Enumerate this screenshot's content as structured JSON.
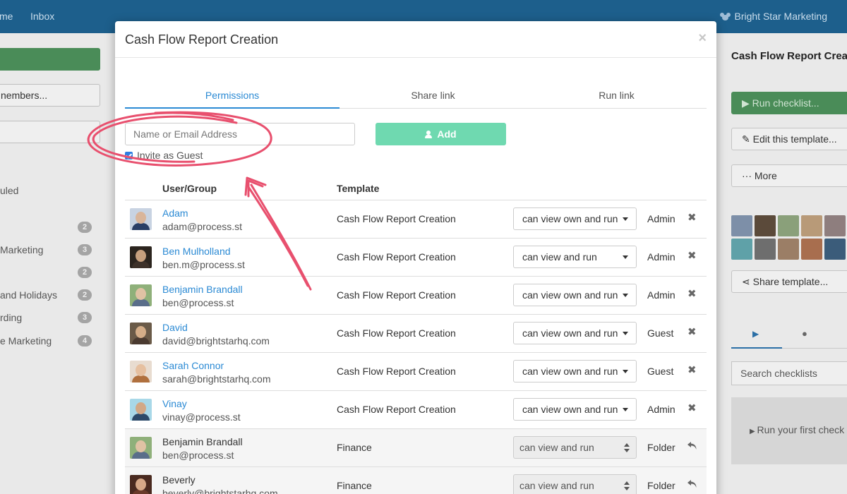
{
  "topbar": {
    "nav_home_fragment": "me",
    "nav_inbox": "Inbox",
    "org_name": "Bright Star Marketing"
  },
  "left_sidebar": {
    "members_fragment": "nembers...",
    "items": [
      {
        "label": "uled",
        "badge": ""
      },
      {
        "label": "",
        "badge": "2"
      },
      {
        "label": "Marketing",
        "badge": "3"
      },
      {
        "label": "",
        "badge": "2"
      },
      {
        "label": "and Holidays",
        "badge": "2"
      },
      {
        "label": "rding",
        "badge": "3"
      },
      {
        "label": "e Marketing",
        "badge": "4"
      }
    ]
  },
  "right_sidebar": {
    "title": "Cash Flow Report Crea",
    "run_checklist": "Run checklist...",
    "edit_template": "Edit this template...",
    "more": "More",
    "share_template": "Share template...",
    "search_placeholder": "Search checklists",
    "empty_state": "Run your first check"
  },
  "modal": {
    "title": "Cash Flow Report Creation",
    "close": "×",
    "tabs": [
      {
        "label": "Permissions",
        "active": true
      },
      {
        "label": "Share link",
        "active": false
      },
      {
        "label": "Run link",
        "active": false
      }
    ],
    "input_placeholder": "Name or Email Address",
    "invite_guest_label": "Invite as Guest",
    "invite_guest_checked": true,
    "add_button": "Add",
    "table": {
      "headers": {
        "user_group": "User/Group",
        "template": "Template"
      },
      "rows": [
        {
          "name": "Adam",
          "email": "adam@process.st",
          "template": "Cash Flow Report Creation",
          "permission": "can view own and run",
          "role": "Admin",
          "inherited": false
        },
        {
          "name": "Ben Mulholland",
          "email": "ben.m@process.st",
          "template": "Cash Flow Report Creation",
          "permission": "can view and run",
          "role": "Admin",
          "inherited": false
        },
        {
          "name": "Benjamin Brandall",
          "email": "ben@process.st",
          "template": "Cash Flow Report Creation",
          "permission": "can view own and run",
          "role": "Admin",
          "inherited": false
        },
        {
          "name": "David",
          "email": "david@brightstarhq.com",
          "template": "Cash Flow Report Creation",
          "permission": "can view own and run",
          "role": "Guest",
          "inherited": false
        },
        {
          "name": "Sarah Connor",
          "email": "sarah@brightstarhq.com",
          "template": "Cash Flow Report Creation",
          "permission": "can view own and run",
          "role": "Guest",
          "inherited": false
        },
        {
          "name": "Vinay",
          "email": "vinay@process.st",
          "template": "Cash Flow Report Creation",
          "permission": "can view own and run",
          "role": "Admin",
          "inherited": false
        },
        {
          "name": "Benjamin Brandall",
          "email": "ben@process.st",
          "template": "Finance",
          "permission": "can view and run",
          "role": "Folder",
          "inherited": true
        },
        {
          "name": "Beverly",
          "email": "beverly@brightstarhq.com",
          "template": "Finance",
          "permission": "can view and run",
          "role": "Folder",
          "inherited": true
        }
      ]
    }
  },
  "colors": {
    "link_blue": "#2b8ad4",
    "add_green": "#6fd9b0",
    "annotation_pink": "#e8506e",
    "topbar": "#1d5f8c"
  }
}
